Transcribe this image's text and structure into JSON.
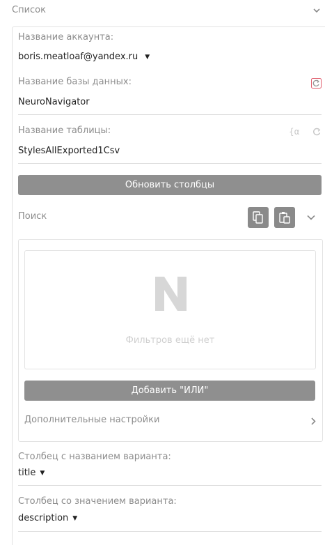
{
  "section": {
    "title": "Список"
  },
  "account": {
    "label": "Название аккаунта:",
    "value": "boris.meatloaf@yandex.ru"
  },
  "database": {
    "label": "Название базы данных:",
    "value": "NeuroNavigator"
  },
  "table": {
    "label": "Название таблицы:",
    "value": "StylesAllExported1Csv"
  },
  "refresh_columns_button": "Обновить столбцы",
  "search": {
    "label": "Поиск"
  },
  "filters": {
    "empty_text": "Фильтров ещё нет"
  },
  "add_or_button": "Добавить \"ИЛИ\"",
  "advanced_settings": "Дополнительные настройки",
  "variant_name_column": {
    "label": "Столбец с названием варианта:",
    "value": "title"
  },
  "variant_value_column": {
    "label": "Столбец со значением варианта:",
    "value": "description"
  },
  "colors": {
    "button_bg": "#8f8f8f",
    "muted_text": "#8c8c8c",
    "alert_icon": "#e05a6a"
  },
  "icons": [
    "chevron-down-icon",
    "refresh-icon",
    "formula-icon",
    "copy-icon",
    "paste-icon",
    "logo-icon",
    "chevron-right-icon",
    "caret-down-icon"
  ]
}
